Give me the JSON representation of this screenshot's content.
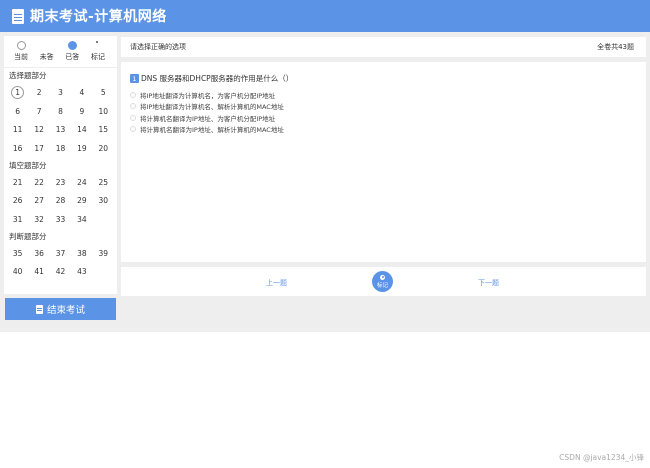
{
  "header": {
    "title": "期末考试-计算机网络",
    "icon": "document-icon"
  },
  "legend": [
    {
      "key": "current",
      "label": "当前"
    },
    {
      "key": "unanswered",
      "label": "未答"
    },
    {
      "key": "answered",
      "label": "已答"
    },
    {
      "key": "flagged",
      "label": "标记"
    }
  ],
  "sections": {
    "choice": {
      "title": "选择题部分",
      "items": [
        "1",
        "2",
        "3",
        "4",
        "5",
        "6",
        "7",
        "8",
        "9",
        "10",
        "11",
        "12",
        "13",
        "14",
        "15",
        "16",
        "17",
        "18",
        "19",
        "20"
      ]
    },
    "fill": {
      "title": "填空题部分",
      "items": [
        "21",
        "22",
        "23",
        "24",
        "25",
        "26",
        "27",
        "28",
        "29",
        "30",
        "31",
        "32",
        "33",
        "34"
      ]
    },
    "judge": {
      "title": "判断题部分",
      "items": [
        "35",
        "36",
        "37",
        "38",
        "39",
        "40",
        "41",
        "42",
        "43"
      ]
    }
  },
  "current_question": "1",
  "end_button": {
    "label": "结束考试",
    "icon": "document-icon"
  },
  "instruction_bar": {
    "instruction": "请选择正确的选项",
    "total": "全卷共43题"
  },
  "question": {
    "number": "1",
    "text": "DNS 服务器和DHCP服务器的作用是什么（）",
    "options": [
      "将IP地址翻译为计算机名，为客户机分配IP地址",
      "将IP地址翻译为计算机名、解析计算机的MAC地址",
      "将计算机名翻译为IP地址、为客户机分配IP地址",
      "将计算机名翻译为IP地址、解析计算机的MAC地址"
    ]
  },
  "nav": {
    "prev": "上一题",
    "mark": "标记",
    "next": "下一题"
  },
  "watermark": "CSDN @java1234_小锋",
  "colors": {
    "accent": "#5b93e6",
    "background": "#eeeeee"
  }
}
